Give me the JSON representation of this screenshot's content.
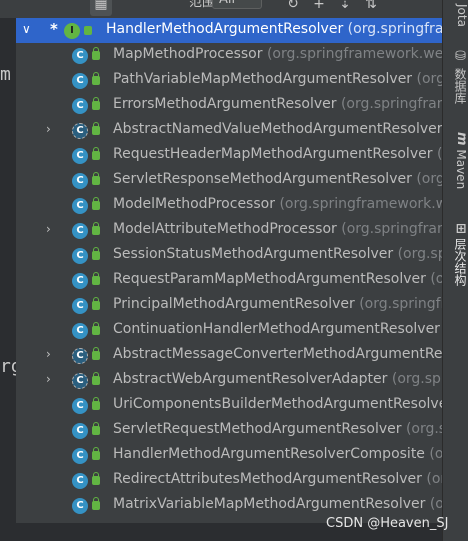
{
  "toolbar": {
    "scope_label": "范围:",
    "scope_value": "All"
  },
  "gutter": {
    "text_top": "m",
    "text_mid": "rg"
  },
  "tree": {
    "root": {
      "name": "HandlerMethodArgumentResolver",
      "package": "(org.springframework"
    },
    "items": [
      {
        "name": "MapMethodProcessor",
        "package": "(org.springframework.web",
        "expandable": false,
        "abstract": false
      },
      {
        "name": "PathVariableMapMethodArgumentResolver",
        "package": "(org.",
        "expandable": false,
        "abstract": false
      },
      {
        "name": "ErrorsMethodArgumentResolver",
        "package": "(org.springframe",
        "expandable": false,
        "abstract": false
      },
      {
        "name": "AbstractNamedValueMethodArgumentResolver",
        "package": "(o",
        "expandable": true,
        "abstract": true
      },
      {
        "name": "RequestHeaderMapMethodArgumentResolver",
        "package": "(o",
        "expandable": false,
        "abstract": false
      },
      {
        "name": "ServletResponseMethodArgumentResolver",
        "package": "(org.s",
        "expandable": false,
        "abstract": false
      },
      {
        "name": "ModelMethodProcessor",
        "package": "(org.springframework.we",
        "expandable": false,
        "abstract": false
      },
      {
        "name": "ModelAttributeMethodProcessor",
        "package": "(org.springfram",
        "expandable": true,
        "abstract": false
      },
      {
        "name": "SessionStatusMethodArgumentResolver",
        "package": "(org.spri",
        "expandable": false,
        "abstract": false
      },
      {
        "name": "RequestParamMapMethodArgumentResolver",
        "package": "(or",
        "expandable": false,
        "abstract": false
      },
      {
        "name": "PrincipalMethodArgumentResolver",
        "package": "(org.springfra",
        "expandable": false,
        "abstract": false
      },
      {
        "name": "ContinuationHandlerMethodArgumentResolver",
        "package": "(",
        "expandable": false,
        "abstract": false
      },
      {
        "name": "AbstractMessageConverterMethodArgumentResc",
        "package": "",
        "expandable": true,
        "abstract": true
      },
      {
        "name": "AbstractWebArgumentResolverAdapter",
        "package": "(org.sprin",
        "expandable": true,
        "abstract": true
      },
      {
        "name": "UriComponentsBuilderMethodArgumentResolver",
        "package": "",
        "expandable": false,
        "abstract": false
      },
      {
        "name": "ServletRequestMethodArgumentResolver",
        "package": "(org.spr",
        "expandable": false,
        "abstract": false
      },
      {
        "name": "HandlerMethodArgumentResolverComposite",
        "package": "(or",
        "expandable": false,
        "abstract": false
      },
      {
        "name": "RedirectAttributesMethodArgumentResolver",
        "package": "(or",
        "expandable": false,
        "abstract": false
      },
      {
        "name": "MatrixVariableMapMethodArgumentResolver",
        "package": "(or",
        "expandable": false,
        "abstract": false
      }
    ]
  },
  "side_tabs": {
    "tab1": "Jota",
    "tab2": "数据库",
    "tab3": "Maven",
    "tab4": "层次结构"
  },
  "watermark": "CSDN @Heaven_SJ"
}
